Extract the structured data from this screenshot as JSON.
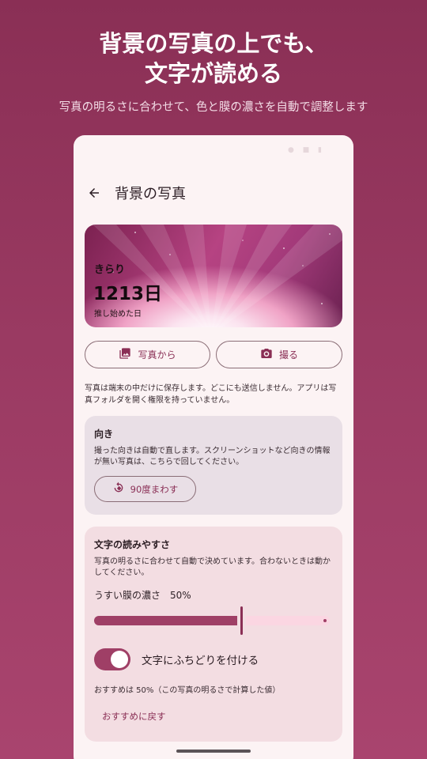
{
  "promo": {
    "title_line1": "背景の写真の上でも、",
    "title_line2": "文字が読める",
    "subtitle": "写真の明るさに合わせて、色と膜の濃さを自動で調整します"
  },
  "appbar": {
    "back_icon": "arrow-left-icon",
    "title": "背景の写真"
  },
  "preview": {
    "name": "きらり",
    "days": "1213日",
    "caption": "推し始めた日"
  },
  "buttons": {
    "gallery_label": "写真から",
    "gallery_icon": "image-gallery-icon",
    "camera_label": "撮る",
    "camera_icon": "camera-icon"
  },
  "privacy_note": "写真は端末の中だけに保存します。どこにも送信しません。アプリは写真フォルダを開く権限を持っていません。",
  "orientation": {
    "title": "向き",
    "description": "撮った向きは自動で直します。スクリーンショットなど向きの情報が無い写真は、こちらで回してください。",
    "rotate_label": "90度まわす",
    "rotate_icon": "rotate-icon"
  },
  "readability": {
    "title": "文字の読みやすさ",
    "description": "写真の明るさに合わせて自動で決めています。合わないときは動かしてください。",
    "film_label": "うすい膜の濃さ　50%",
    "film_value": 0.5,
    "outline_toggle_label": "文字にふちどりを付ける",
    "outline_toggle_on": true,
    "recommend_note": "おすすめは 50%（この写真の明るさで計算した値）",
    "reset_label": "おすすめに戻す"
  },
  "colors": {
    "accent": "#8a2f55",
    "slider_active": "#9f3f66",
    "slider_inactive": "#fbd6e2",
    "background": "#9a3a62",
    "surface": "#fcf3f4"
  }
}
